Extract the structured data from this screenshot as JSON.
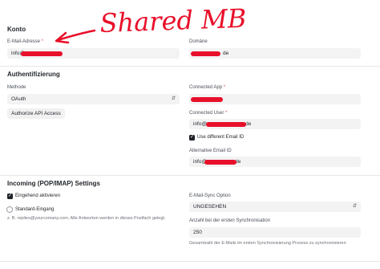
{
  "annotation": {
    "handwritten_text": "Shared MB",
    "arrow": "arrow-pointing-to-email-field"
  },
  "konto": {
    "title": "Konto",
    "email_label": "E-Mail-Adresse",
    "email_required": "*",
    "email_value": "info@",
    "domain_label": "Domäne",
    "domain_value": "de"
  },
  "auth": {
    "title": "Authentifizierung",
    "method_label": "Methode",
    "method_value": "OAuth",
    "authorize_button": "Authorize API Access",
    "connected_app_label": "Connected App",
    "connected_app_required": "*",
    "connected_user_label": "Connected User",
    "connected_user_required": "*",
    "connected_user_value_prefix": "info@",
    "connected_user_value_suffix": "de",
    "use_different_email_label": "Use different Email ID",
    "use_different_email_checked": true,
    "alt_email_label": "Alternative Email ID",
    "alt_email_prefix": "info@",
    "alt_email_suffix": "de"
  },
  "incoming": {
    "title": "Incoming (POP/IMAP) Settings",
    "eingehend_label": "Eingehend aktivieren",
    "eingehend_checked": true,
    "standard_label": "Standard-Eingang",
    "standard_selected": false,
    "help_text": "z. B. replies@yourcomany.com. Alle Antworten werden in dieses Postfach gelegt.",
    "sync_option_label": "E-Mail-Sync Option",
    "sync_option_value": "UNGESEHEN",
    "sync_count_label": "Anzahl bei der ersten Synchronisation",
    "sync_count_value": "250",
    "sync_help": "Gesamtzahl der E-Mails im ersten Synchronisierung Prozess zu synchronisieren"
  },
  "colors": {
    "redaction": "#e8102a",
    "checkbox": "#1f2328",
    "field_bg": "#f3f3f4"
  }
}
